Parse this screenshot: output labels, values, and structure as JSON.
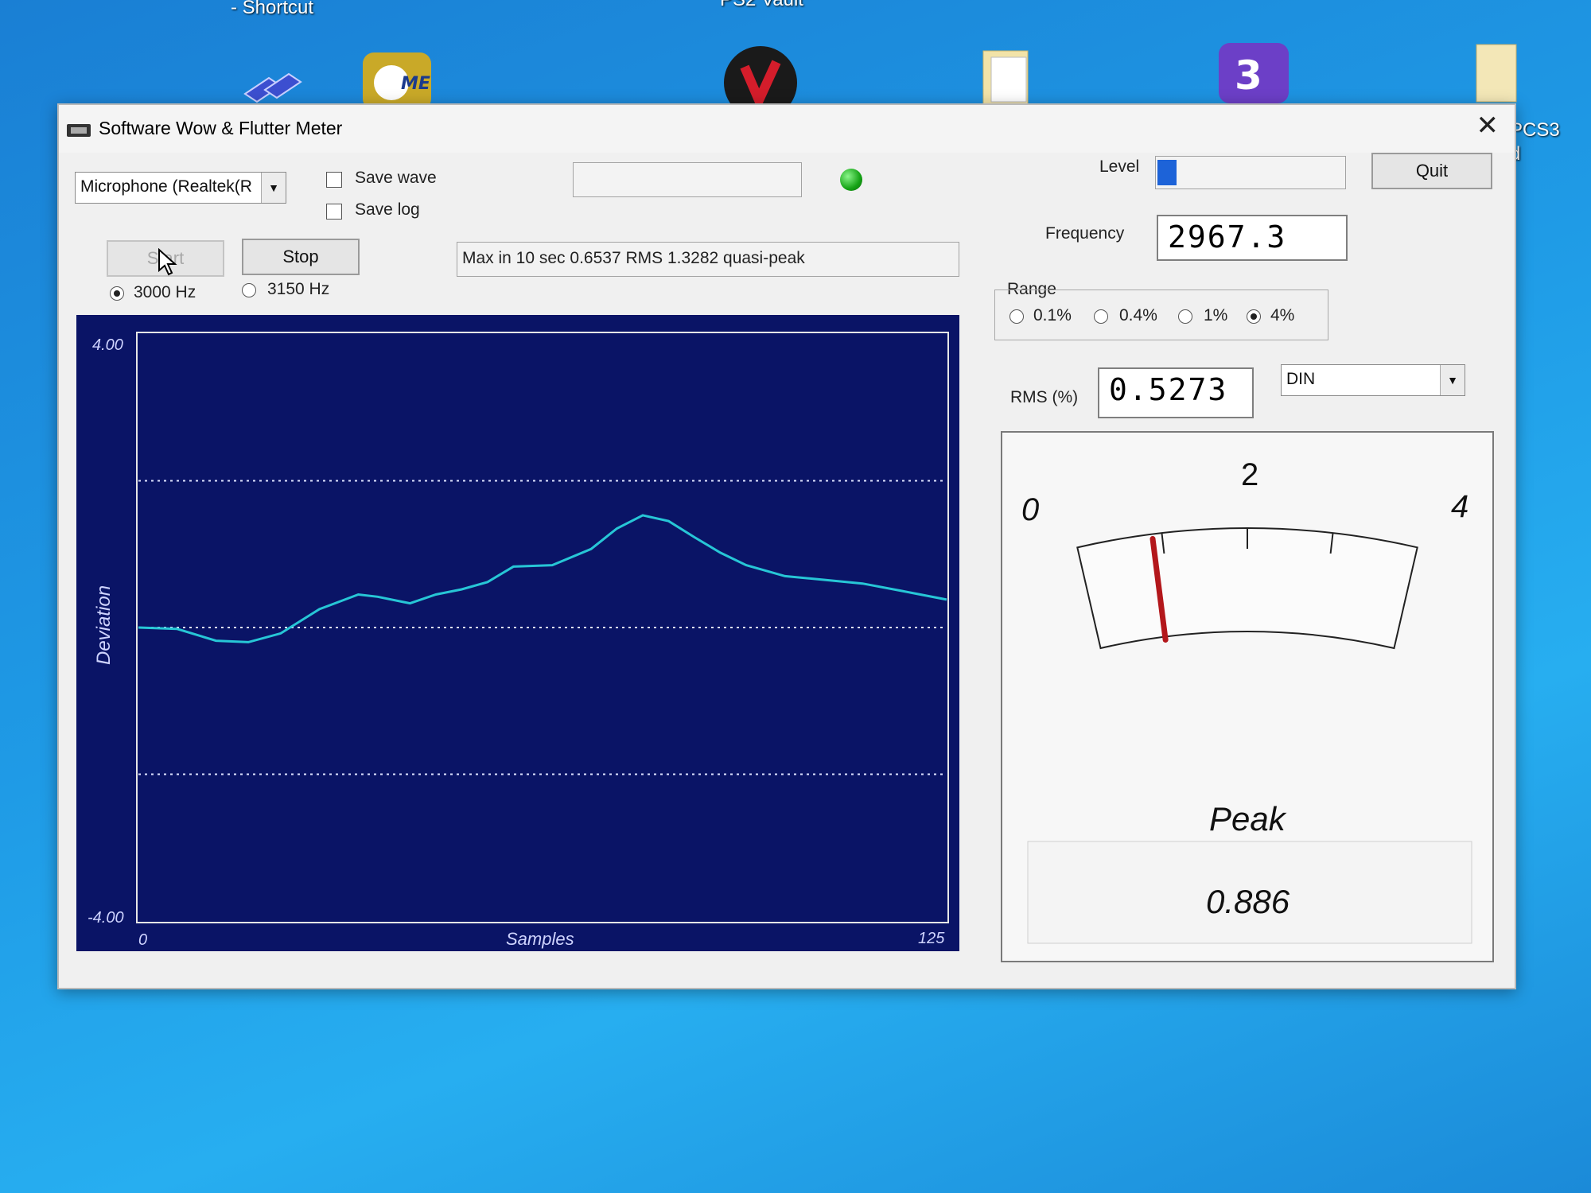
{
  "desktop": {
    "top_labels": [
      "- Shortcut",
      "PS2 Vault"
    ],
    "side_labels": [
      "PCS3",
      "d"
    ]
  },
  "window": {
    "title": "Software Wow & Flutter Meter",
    "close_glyph": "✕"
  },
  "controls": {
    "input_device": "Microphone (Realtek(R",
    "save_wave_label": "Save wave",
    "save_log_label": "Save log",
    "start_label": "Start",
    "stop_label": "Stop",
    "freq_3000_label": "3000 Hz",
    "freq_3150_label": "3150 Hz",
    "selected_frequency": "3000 Hz",
    "status_text": "Max in 10 sec 0.6537 RMS 1.3282 quasi-peak",
    "level_label": "Level",
    "level_fraction": 0.1,
    "quit_label": "Quit",
    "frequency_label": "Frequency",
    "frequency_value": "2967.3",
    "range_label": "Range",
    "range_options": [
      "0.1%",
      "0.4%",
      "1%",
      "4%"
    ],
    "range_selected": "4%",
    "rms_label": "RMS (%)",
    "rms_value": "0.5273",
    "weighting": "DIN",
    "led_color": "#15a315"
  },
  "chart_data": {
    "type": "line",
    "xlabel": "Samples",
    "ylabel": "Deviation",
    "xlim": [
      0,
      125
    ],
    "ylim": [
      -4.0,
      4.0
    ],
    "x_ticks": [
      "0",
      "125"
    ],
    "y_ticks": [
      "4.00",
      "-4.00"
    ],
    "grid": "dotted",
    "x": [
      0,
      6,
      12,
      17,
      22,
      28,
      34,
      37,
      42,
      46,
      50,
      54,
      58,
      64,
      70,
      74,
      78,
      82,
      86,
      90,
      94,
      100,
      106,
      112,
      118,
      125
    ],
    "values": [
      0.0,
      -0.02,
      -0.18,
      -0.2,
      -0.08,
      0.25,
      0.45,
      0.42,
      0.33,
      0.45,
      0.52,
      0.62,
      0.83,
      0.85,
      1.07,
      1.35,
      1.53,
      1.45,
      1.23,
      1.02,
      0.85,
      0.7,
      0.65,
      0.6,
      0.5,
      0.38
    ],
    "line_color": "#27c6d6"
  },
  "meter": {
    "scale_labels": [
      "0",
      "2",
      "4"
    ],
    "value": 0.886,
    "max": 4,
    "mode_label": "Peak",
    "readout": "0.886",
    "needle_color": "#b3171b"
  }
}
